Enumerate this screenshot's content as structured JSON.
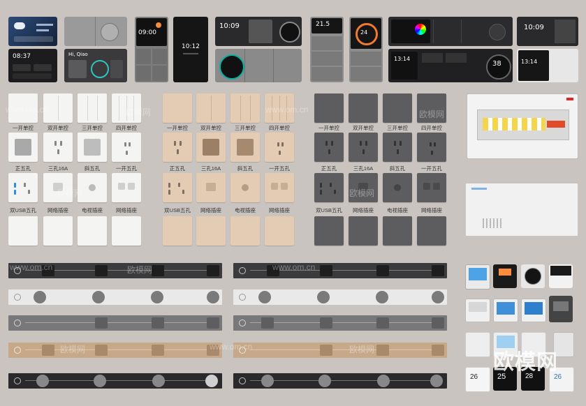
{
  "screens": {
    "s1_time": "08:37",
    "s2_greeting": "Hi, Qiao",
    "s3_time": "09:00",
    "s4_time": "10:12",
    "s5_time": "10:09",
    "s6_temp": "21.5",
    "s7_temp": "24",
    "s8_time": "13:14",
    "s9_time": "13:14",
    "s10_time": "10:09",
    "s11_value": "38"
  },
  "white_switches": {
    "row1": [
      "一开单控",
      "双开单控",
      "三开单控",
      "四开单控"
    ],
    "row2": [
      "正五孔",
      "三孔16A",
      "斜五孔",
      "一开五孔"
    ],
    "row3": [
      "双USB五孔",
      "网络插座",
      "电视插座",
      "网络插座"
    ]
  },
  "beige_switches": {
    "row1": [
      "一开单控",
      "双开单控",
      "三开单控",
      "四开单控"
    ],
    "row2": [
      "正五孔",
      "三孔16A",
      "斜五孔",
      "一开五孔"
    ],
    "row3": [
      "双USB五孔",
      "网络插座",
      "电视插座",
      "网络插座"
    ]
  },
  "grey_switches": {
    "row1": [
      "一开单控",
      "双开单控",
      "三开单控",
      "四开单控"
    ],
    "row2": [
      "正五孔",
      "三孔16A",
      "斜五孔",
      "一开五孔"
    ],
    "row3": [
      "双USB五孔",
      "网络插座",
      "电视插座",
      "网络插座"
    ]
  },
  "thermostats": [
    "26",
    "25",
    "28",
    "26"
  ],
  "watermark": {
    "site": "www.om.cn",
    "brand": "欧模网"
  },
  "colors": {
    "background": "#c9c4bf",
    "white_panel": "#f4f4f2",
    "beige_panel": "#e3cbb4",
    "grey_panel": "#5d5d5f",
    "screen_dark": "#1c1c1e"
  }
}
